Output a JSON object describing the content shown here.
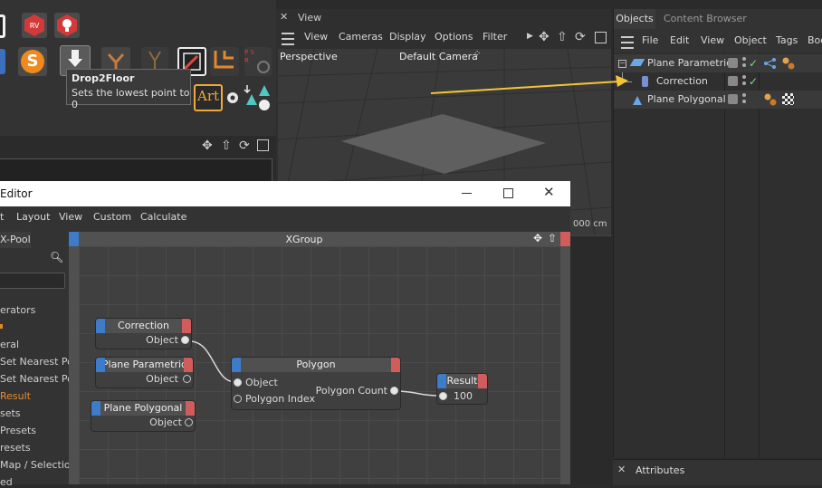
{
  "toolbar": {
    "tooltip_title": "Drop2Floor",
    "tooltip_text": "Sets the lowest point to 0",
    "art_label": "Art",
    "s_icon_label": "S",
    "psr_label": "P S R"
  },
  "viewport": {
    "panel_title": "View",
    "menu": [
      "View",
      "Cameras",
      "Display",
      "Options",
      "Filter"
    ],
    "projection": "Perspective",
    "camera": "Default Camera",
    "grid_spacing": "000 cm"
  },
  "objects_panel": {
    "tabs": [
      "Objects",
      "Content Browser"
    ],
    "menu": [
      "File",
      "Edit",
      "View",
      "Object",
      "Tags",
      "Boo"
    ],
    "rows": [
      {
        "name": "Plane Parametric"
      },
      {
        "name": "Correction"
      },
      {
        "name": "Plane Polygonal"
      }
    ]
  },
  "attributes_panel": {
    "title": "Attributes"
  },
  "xpresso": {
    "window_title": "Editor",
    "menu": [
      "t",
      "Layout",
      "View",
      "Custom",
      "Calculate"
    ],
    "pool_tab": "X-Pool",
    "pool_items": [
      "erators",
      "",
      "eral",
      "Set Nearest Poi",
      "Set Nearest Poi",
      "Result",
      "sets",
      "Presets",
      "resets",
      "Map / Selection",
      "ed"
    ],
    "group_title": "XGroup",
    "nodes": {
      "correction": {
        "title": "Correction",
        "port": "Object"
      },
      "plane_parametric": {
        "title": "Plane Parametric",
        "port": "Object"
      },
      "plane_polygonal": {
        "title": "Plane Polygonal",
        "port": "Object"
      },
      "polygon": {
        "title": "Polygon",
        "in_ports": [
          "Object",
          "Polygon Index"
        ],
        "out_port": "Polygon Count"
      },
      "result": {
        "title": "Result",
        "value": "100"
      }
    }
  },
  "colors": {
    "port_blue": "#3e7cc9",
    "port_red": "#d05c5c",
    "arrow": "#f2c436",
    "check": "#7fd97f",
    "highlight": "#f2a83a"
  }
}
